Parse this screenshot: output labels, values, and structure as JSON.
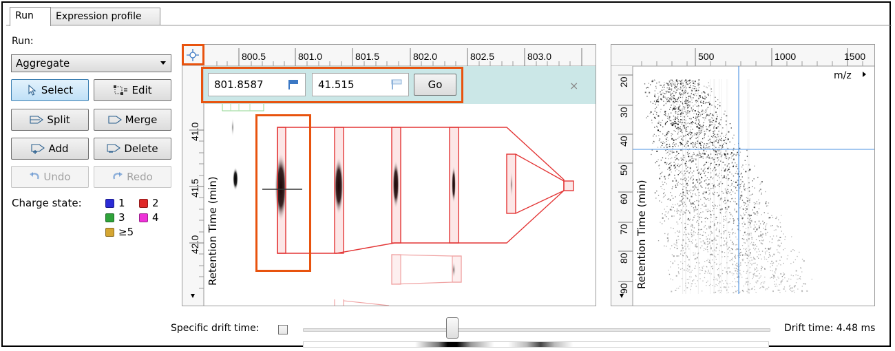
{
  "tabs": [
    {
      "label": "Run",
      "active": true
    },
    {
      "label": "Expression profile",
      "active": false
    }
  ],
  "run": {
    "label": "Run:",
    "selected": "Aggregate"
  },
  "tools": {
    "select": "Select",
    "edit": "Edit",
    "split": "Split",
    "merge": "Merge",
    "add": "Add",
    "delete": "Delete",
    "undo": "Undo",
    "redo": "Redo"
  },
  "charge": {
    "label": "Charge state:",
    "states": [
      {
        "label": "1",
        "color": "#2b2bd6"
      },
      {
        "label": "2",
        "color": "#e02828"
      },
      {
        "label": "3",
        "color": "#2fa33a"
      },
      {
        "label": "4",
        "color": "#ee32d8"
      },
      {
        "label": "≥5",
        "color": "#d5a632"
      }
    ]
  },
  "detail": {
    "mz_ticks": [
      "800.5",
      "801.0",
      "801.5",
      "802.0",
      "802.5",
      "803.0"
    ],
    "rt_ticks": [
      "41.0",
      "41.5",
      "42.0"
    ],
    "ylabel": "Retention Time (min)",
    "goto": {
      "mz_value": "801.8587",
      "rt_value": "41.515",
      "go_label": "Go",
      "close_glyph": "×"
    }
  },
  "overview": {
    "mz_ticks": [
      "500",
      "1000",
      "1500"
    ],
    "xlabel": "m/z",
    "rt_ticks": [
      "20",
      "30",
      "40",
      "50",
      "60",
      "70",
      "80",
      "90"
    ],
    "ylabel": "Retention Time (min)"
  },
  "drift": {
    "specific_label": "Specific drift time:",
    "specific_checked": false,
    "readout": "Drift time: 4.48 ms",
    "slider_fraction": 0.32
  },
  "colors": {
    "highlight": "#e8530e",
    "feature": "#e33535",
    "crosshair": "#4a90e2",
    "goto_band": "#cbe7e7"
  }
}
